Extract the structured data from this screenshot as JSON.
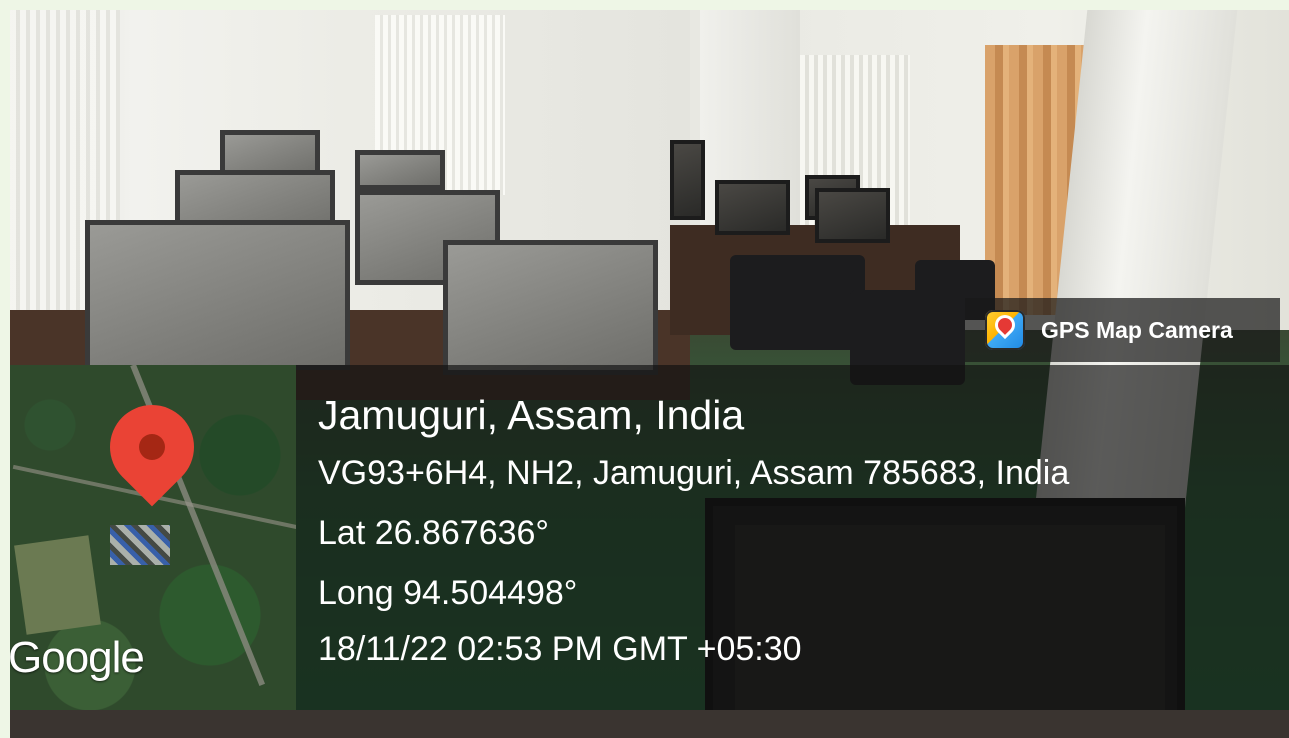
{
  "badge": {
    "app_name": "GPS Map Camera",
    "icon": "gps-map-camera-app-icon"
  },
  "map": {
    "attribution": "Google",
    "pin_icon": "map-pin-icon",
    "pin_color": "#ea4335"
  },
  "location": {
    "title": "Jamuguri, Assam, India",
    "address": "VG93+6H4, NH2, Jamuguri, Assam 785683, India",
    "latitude": "Lat 26.867636°",
    "longitude": "Long 94.504498°",
    "timestamp": "18/11/22 02:53 PM GMT +05:30"
  },
  "colors": {
    "page_border": "#eef6e6",
    "overlay": "rgba(18,18,18,.68)",
    "text": "#ffffff"
  }
}
